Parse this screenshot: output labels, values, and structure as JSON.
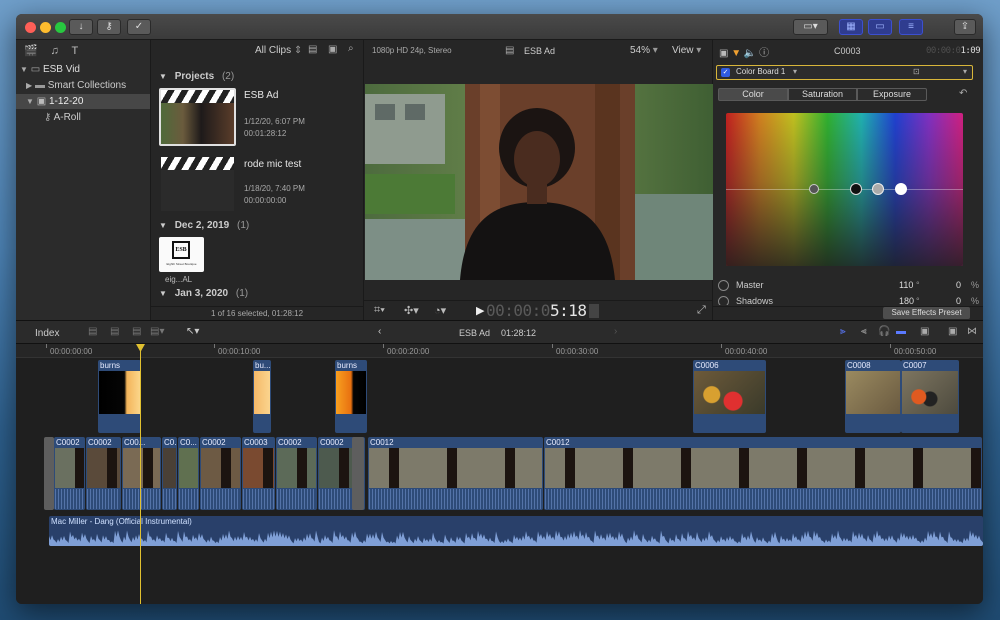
{
  "libraries": {
    "header_label": "All Clips",
    "library_name": "ESB Vid",
    "items": [
      {
        "label": "Smart Collections"
      },
      {
        "label": "1-12-20"
      },
      {
        "label": "A-Roll"
      }
    ]
  },
  "browser": {
    "groups": [
      {
        "title": "Projects",
        "count": "(2)"
      },
      {
        "title": "Dec 2, 2019",
        "count": "(1)"
      },
      {
        "title": "Jan 3, 2020",
        "count": "(1)"
      }
    ],
    "projects": [
      {
        "name": "ESB Ad",
        "date": "1/12/20, 6:07 PM",
        "duration": "00:01:28:12"
      },
      {
        "name": "rode mic test",
        "date": "1/18/20, 7:40 PM",
        "duration": "00:00:00:00"
      }
    ],
    "event_clip": {
      "name": "eig...AL",
      "logo_text": "ESB",
      "logo_sub": "Eighth Street Boutique"
    },
    "status": "1 of 16 selected, 01:28:12"
  },
  "viewer": {
    "format": "1080p HD 24p, Stereo",
    "project": "ESB Ad",
    "zoom": "54%",
    "view_menu": "View",
    "timecode_dim": "00:00:0",
    "timecode_bright": "5:18"
  },
  "inspector": {
    "clip_name": "C0003",
    "duration_dim": "00:00:0",
    "duration_bright": "1:09",
    "effect_name": "Color Board 1",
    "tabs": [
      "Color",
      "Saturation",
      "Exposure"
    ],
    "controls": [
      {
        "label": "Master",
        "angle": "110",
        "unit": "°",
        "percent": "0",
        "pct_unit": "%"
      },
      {
        "label": "Shadows",
        "angle": "180",
        "unit": "°",
        "percent": "0",
        "pct_unit": "%"
      }
    ],
    "puck_levels": {
      "master": 0.55,
      "shadows": 0.09,
      "midtones": 0.0,
      "highlights": 0.21
    },
    "save_button": "Save Effects Preset"
  },
  "timeline": {
    "index_label": "Index",
    "project": "ESB Ad",
    "duration": "01:28:12",
    "ruler": [
      "00:00:00:00",
      "00:00:10:00",
      "00:00:20:00",
      "00:00:30:00",
      "00:00:40:00",
      "00:00:50:00"
    ],
    "connected_clips": [
      "burns",
      "bu...",
      "burns",
      "C0006",
      "C0008",
      "C0007"
    ],
    "primary_clips": [
      "C0002",
      "C0002",
      "C00...",
      "C0...",
      "C0...",
      "C0002",
      "C0003",
      "C0002",
      "C0002",
      "C0012",
      "C0012"
    ],
    "audio_clip": "Mac Miller - Dang (Official Instrumental)"
  },
  "colors": {
    "accent": "#2f48c8",
    "playhead": "#e0c030",
    "video_clip": "#2e4b78",
    "audio_clip": "#29406a"
  }
}
